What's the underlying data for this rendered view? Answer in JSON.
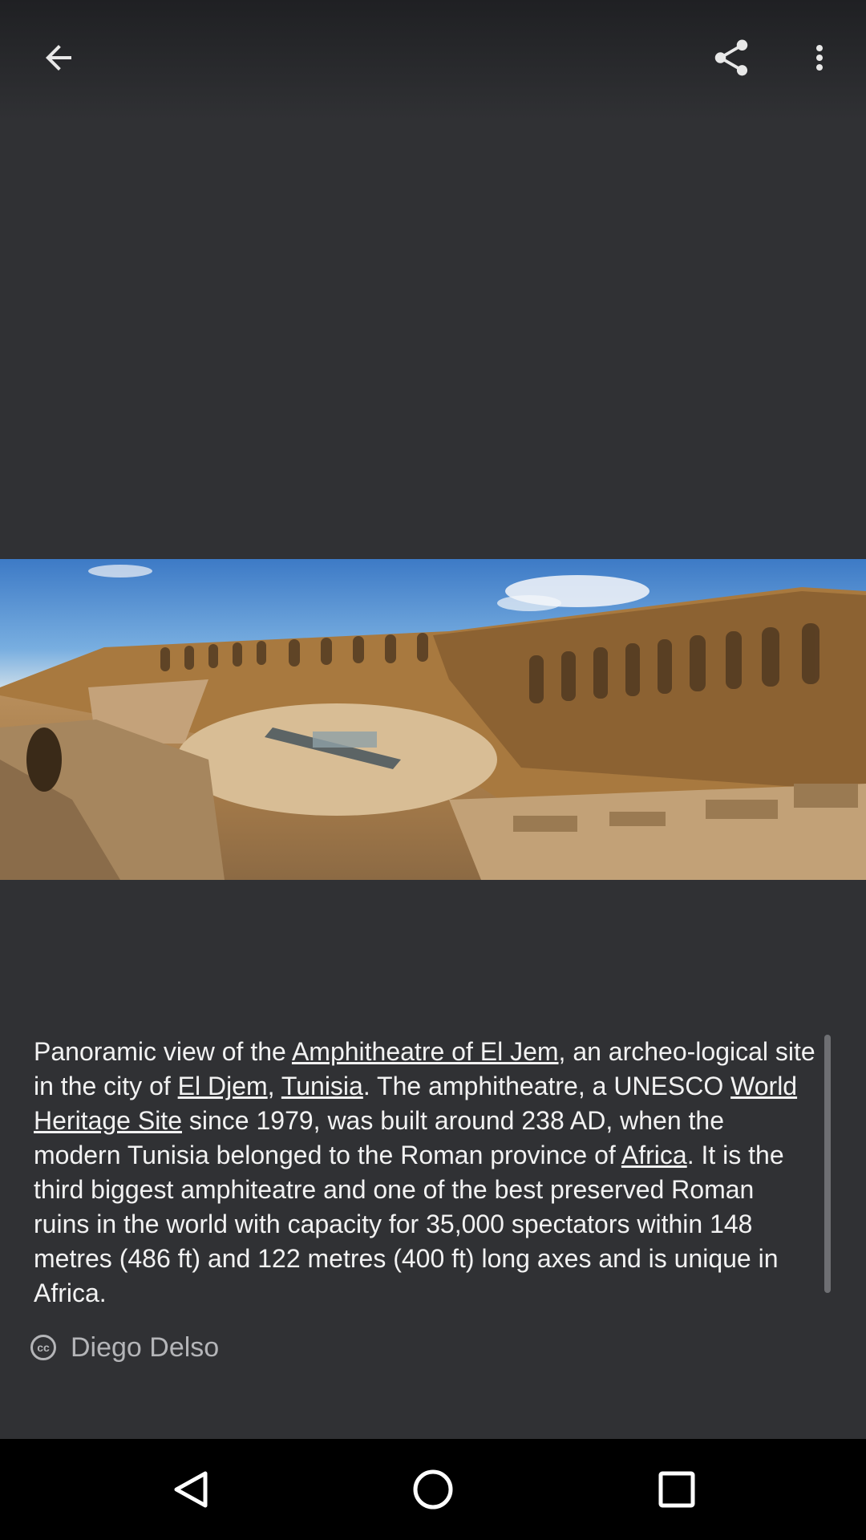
{
  "toolbar": {
    "back_icon": "arrow-left-icon",
    "share_icon": "share-icon",
    "more_icon": "more-vert-icon"
  },
  "photo": {
    "subject": "Amphitheatre of El Jem panoramic photo"
  },
  "caption": {
    "part1": "Panoramic view of the ",
    "link1": "Amphitheatre of El Jem",
    "part2": ", an archeo-logical site in the city of ",
    "link2": "El Djem",
    "part3": ", ",
    "link3": "Tunisia",
    "part4": ". The amphitheatre, a UNESCO ",
    "link4": "World Heritage Site",
    "part5": " since 1979, was built around 238 AD, when the modern Tunisia belonged to the Roman province of ",
    "link5": "Africa",
    "part6": ". It is the third biggest amphiteatre and one of the best preserved Roman ruins in the world with capacity for 35,000 spectators within 148 metres (486 ft) and 122 metres (400 ft) long axes and is unique in Africa."
  },
  "credit": {
    "license_icon": "cc-icon",
    "license_text": "cc",
    "author": "Diego Delso"
  },
  "navbar": {
    "back_icon": "nav-back-triangle-icon",
    "home_icon": "nav-home-circle-icon",
    "recents_icon": "nav-recents-square-icon"
  },
  "colors": {
    "background": "#303134",
    "caption_text": "#f2f2f2",
    "credit_text": "#b4b5b8",
    "navbar": "#000000"
  }
}
